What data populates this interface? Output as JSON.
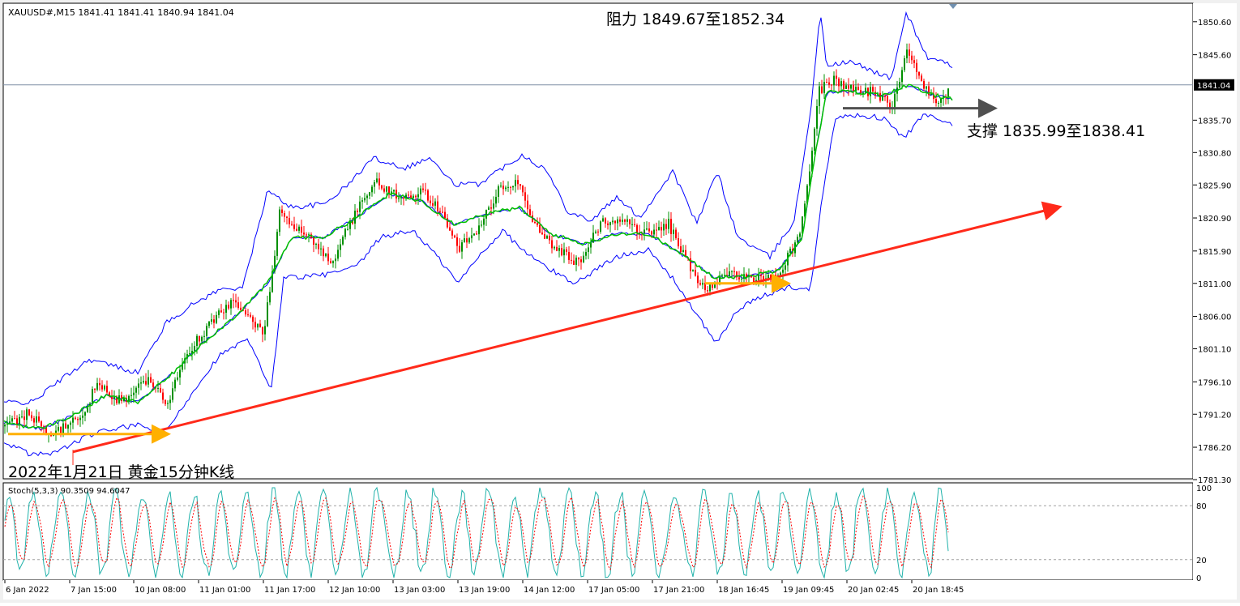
{
  "colors": {
    "background": "#ffffff",
    "axis": "#000000",
    "band": "#0000ff",
    "ma": "#00c000",
    "candle_up": "#009000",
    "candle_down": "#ff0000",
    "trendline": "#ff2a1a",
    "support_arrow": "#ffb000",
    "support_arrow2": "#505050",
    "stoch_main": "#20b2aa",
    "stoch_signal": "#ff0000",
    "price_line": "#7f8fa6"
  },
  "main": {
    "header": "XAUUSD#,M15  1841.41 1841.41 1840.94 1841.04",
    "resistance_label": "阻力 1849.67至1852.34",
    "support_label": "支撑 1835.99至1838.41",
    "caption": "2022年1月21日 黄金15分钟K线",
    "current_price": "1841.04"
  },
  "stoch": {
    "header": "Stoch(5,3,3) 90.3509 94.6047",
    "ticks": [
      "100",
      "80",
      "20",
      "0"
    ]
  },
  "chart_data": {
    "type": "candlestick",
    "symbol": "XAUUSD#",
    "timeframe": "M15",
    "ylim": [
      1781.3,
      1852.6
    ],
    "y_ticks": [
      "1850.60",
      "1845.60",
      "1841.04",
      "1835.70",
      "1830.80",
      "1825.90",
      "1820.90",
      "1815.90",
      "1811.00",
      "1806.00",
      "1801.10",
      "1796.10",
      "1791.20",
      "1786.20",
      "1781.30"
    ],
    "x_ticks": [
      "6 Jan 2022",
      "7 Jan 15:00",
      "10 Jan 08:00",
      "11 Jan 01:00",
      "11 Jan 17:00",
      "12 Jan 10:00",
      "13 Jan 03:00",
      "13 Jan 19:00",
      "14 Jan 12:00",
      "17 Jan 05:00",
      "17 Jan 21:00",
      "18 Jan 16:45",
      "19 Jan 09:45",
      "20 Jan 02:45",
      "20 Jan 18:45"
    ],
    "close_trace": [
      [
        0,
        1789.0
      ],
      [
        35,
        1791.5
      ],
      [
        60,
        1788.0
      ],
      [
        100,
        1790.5
      ],
      [
        120,
        1796.0
      ],
      [
        150,
        1793.0
      ],
      [
        185,
        1797.0
      ],
      [
        205,
        1792.5
      ],
      [
        230,
        1800.5
      ],
      [
        260,
        1805.0
      ],
      [
        290,
        1808.5
      ],
      [
        325,
        1803.0
      ],
      [
        345,
        1821.5
      ],
      [
        380,
        1818.0
      ],
      [
        410,
        1814.5
      ],
      [
        440,
        1822.0
      ],
      [
        465,
        1826.5
      ],
      [
        490,
        1824.0
      ],
      [
        520,
        1825.0
      ],
      [
        545,
        1822.0
      ],
      [
        565,
        1816.0
      ],
      [
        590,
        1819.5
      ],
      [
        615,
        1825.0
      ],
      [
        640,
        1826.5
      ],
      [
        665,
        1818.5
      ],
      [
        690,
        1816.0
      ],
      [
        715,
        1814.0
      ],
      [
        740,
        1820.0
      ],
      [
        765,
        1820.5
      ],
      [
        800,
        1818.5
      ],
      [
        825,
        1820.0
      ],
      [
        845,
        1815.0
      ],
      [
        870,
        1810.0
      ],
      [
        900,
        1813.0
      ],
      [
        925,
        1811.5
      ],
      [
        960,
        1812.0
      ],
      [
        985,
        1818.0
      ],
      [
        1000,
        1828.0
      ],
      [
        1010,
        1840.0
      ],
      [
        1030,
        1842.0
      ],
      [
        1045,
        1840.5
      ],
      [
        1080,
        1840.0
      ],
      [
        1100,
        1838.0
      ],
      [
        1120,
        1846.5
      ],
      [
        1140,
        1841.0
      ],
      [
        1160,
        1838.0
      ],
      [
        1172,
        1841.0
      ]
    ],
    "upper_band": [
      [
        5,
        1793.0
      ],
      [
        40,
        1793.0
      ],
      [
        70,
        1796.0
      ],
      [
        110,
        1799.5
      ],
      [
        140,
        1798.5
      ],
      [
        170,
        1797.5
      ],
      [
        205,
        1805.0
      ],
      [
        240,
        1808.0
      ],
      [
        270,
        1810.0
      ],
      [
        300,
        1810.5
      ],
      [
        330,
        1825.0
      ],
      [
        360,
        1822.5
      ],
      [
        400,
        1823.0
      ],
      [
        430,
        1826.0
      ],
      [
        460,
        1830.0
      ],
      [
        500,
        1828.5
      ],
      [
        530,
        1830.0
      ],
      [
        560,
        1826.0
      ],
      [
        590,
        1826.0
      ],
      [
        620,
        1828.5
      ],
      [
        645,
        1830.5
      ],
      [
        675,
        1828.0
      ],
      [
        700,
        1822.0
      ],
      [
        730,
        1820.5
      ],
      [
        760,
        1824.0
      ],
      [
        790,
        1821.0
      ],
      [
        830,
        1828.0
      ],
      [
        860,
        1820.0
      ],
      [
        885,
        1828.0
      ],
      [
        910,
        1818.0
      ],
      [
        950,
        1815.0
      ],
      [
        980,
        1820.5
      ],
      [
        1000,
        1837.0
      ],
      [
        1012,
        1852.0
      ],
      [
        1020,
        1844.0
      ],
      [
        1050,
        1844.5
      ],
      [
        1080,
        1843.0
      ],
      [
        1100,
        1842.0
      ],
      [
        1118,
        1852.0
      ],
      [
        1145,
        1845.0
      ],
      [
        1175,
        1844.0
      ]
    ],
    "lower_band": [
      [
        5,
        1787.0
      ],
      [
        40,
        1785.0
      ],
      [
        70,
        1785.5
      ],
      [
        110,
        1788.0
      ],
      [
        140,
        1789.0
      ],
      [
        170,
        1789.5
      ],
      [
        205,
        1788.5
      ],
      [
        240,
        1795.0
      ],
      [
        270,
        1800.0
      ],
      [
        305,
        1802.5
      ],
      [
        335,
        1795.0
      ],
      [
        350,
        1812.0
      ],
      [
        380,
        1812.0
      ],
      [
        410,
        1812.5
      ],
      [
        440,
        1813.5
      ],
      [
        470,
        1818.0
      ],
      [
        510,
        1819.0
      ],
      [
        540,
        1815.0
      ],
      [
        565,
        1811.0
      ],
      [
        590,
        1815.0
      ],
      [
        620,
        1819.0
      ],
      [
        650,
        1815.5
      ],
      [
        680,
        1813.0
      ],
      [
        710,
        1811.0
      ],
      [
        740,
        1813.5
      ],
      [
        770,
        1815.5
      ],
      [
        800,
        1816.0
      ],
      [
        835,
        1811.0
      ],
      [
        860,
        1806.0
      ],
      [
        885,
        1802.0
      ],
      [
        910,
        1807.0
      ],
      [
        940,
        1809.0
      ],
      [
        975,
        1810.5
      ],
      [
        1000,
        1810.0
      ],
      [
        1012,
        1822.0
      ],
      [
        1030,
        1836.0
      ],
      [
        1060,
        1836.5
      ],
      [
        1090,
        1836.0
      ],
      [
        1115,
        1833.0
      ],
      [
        1140,
        1836.5
      ],
      [
        1175,
        1835.0
      ]
    ],
    "ma_trace": [
      [
        5,
        1790.0
      ],
      [
        50,
        1789.0
      ],
      [
        90,
        1791.0
      ],
      [
        130,
        1794.0
      ],
      [
        170,
        1793.0
      ],
      [
        210,
        1797.0
      ],
      [
        250,
        1802.0
      ],
      [
        290,
        1806.0
      ],
      [
        330,
        1811.0
      ],
      [
        360,
        1818.0
      ],
      [
        400,
        1818.0
      ],
      [
        440,
        1821.0
      ],
      [
        480,
        1824.5
      ],
      [
        520,
        1823.5
      ],
      [
        560,
        1820.0
      ],
      [
        600,
        1821.5
      ],
      [
        640,
        1822.5
      ],
      [
        680,
        1818.5
      ],
      [
        720,
        1817.0
      ],
      [
        760,
        1818.5
      ],
      [
        800,
        1818.5
      ],
      [
        840,
        1815.5
      ],
      [
        880,
        1812.0
      ],
      [
        920,
        1812.0
      ],
      [
        960,
        1813.0
      ],
      [
        990,
        1818.0
      ],
      [
        1005,
        1830.0
      ],
      [
        1020,
        1840.0
      ],
      [
        1050,
        1840.0
      ],
      [
        1090,
        1839.5
      ],
      [
        1120,
        1841.0
      ],
      [
        1150,
        1839.5
      ],
      [
        1175,
        1839.0
      ]
    ],
    "trendline": {
      "from": [
        90,
        1785.5
      ],
      "to": [
        1305,
        1822.5
      ]
    },
    "arrows": [
      {
        "from": [
          10,
          1788.2
        ],
        "to": [
          205,
          1788.2
        ]
      },
      {
        "from": [
          870,
          1811.0
        ],
        "to": [
          970,
          1811.0
        ]
      },
      {
        "from": [
          1040,
          1837.5
        ],
        "to": [
          1225,
          1837.5
        ]
      }
    ],
    "stoch_levels": [
      80,
      20
    ]
  }
}
